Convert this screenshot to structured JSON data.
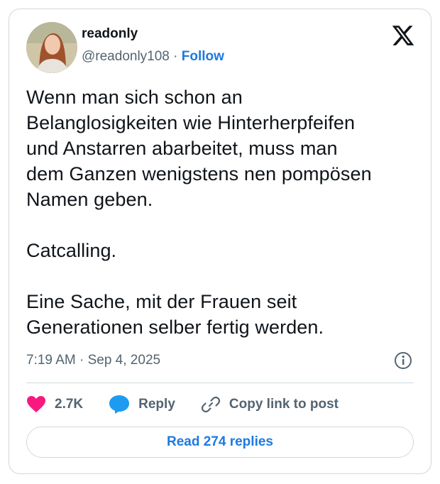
{
  "author": {
    "display_name": "readonly",
    "handle": "@readonly108",
    "separator": "·",
    "follow_label": "Follow"
  },
  "tweet": {
    "text": "Wenn man sich schon an\nBelanglosigkeiten wie Hinterherpfeifen\nund Anstarren abarbeitet, muss man\ndem Ganzen wenigstens nen pompösen\nNamen geben.\n\nCatcalling.\n\nEine Sache, mit der Frauen seit\nGenerationen selber fertig werden.",
    "timestamp": "7:19 AM · Sep 4, 2025"
  },
  "actions": {
    "likes": "2.7K",
    "reply_label": "Reply",
    "copy_link_label": "Copy link to post"
  },
  "read_replies_label": "Read 274 replies",
  "icons": {
    "brand": "x-logo-icon",
    "info": "info-icon",
    "like": "heart-icon",
    "reply": "speech-bubble-icon",
    "copy": "link-icon"
  },
  "colors": {
    "accent": "#1d7ae0",
    "heart": "#f91880",
    "reply_bubble": "#1d9bf0",
    "muted_text": "#536471",
    "border": "#cfd9de"
  }
}
